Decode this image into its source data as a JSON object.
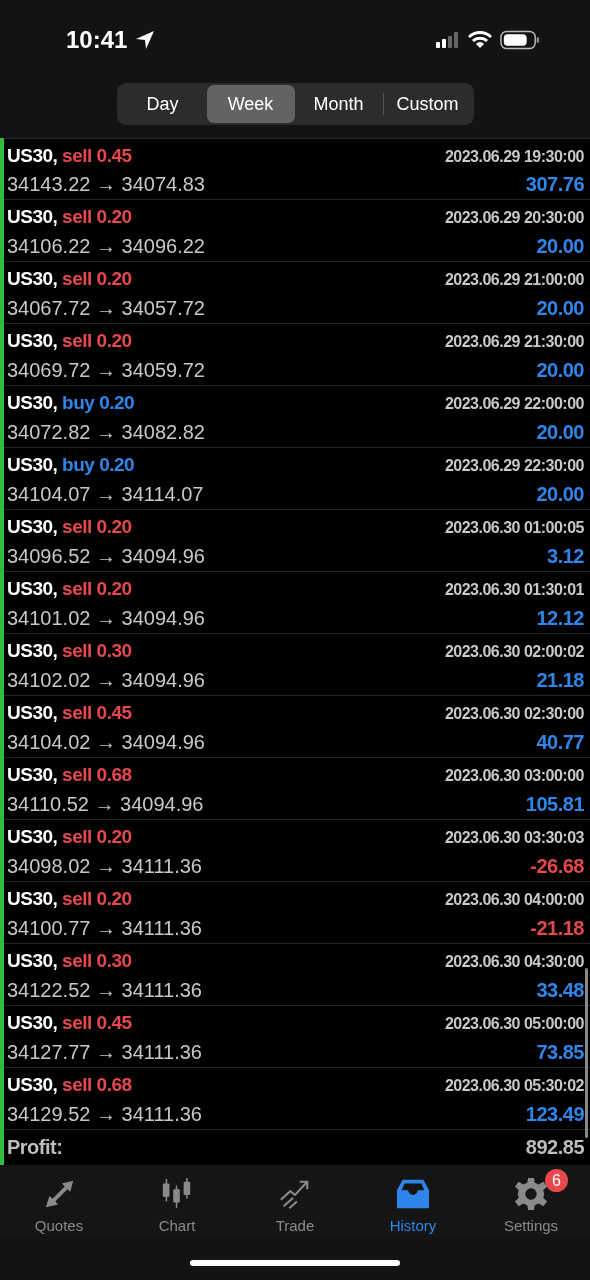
{
  "status_bar": {
    "time": "10:41"
  },
  "period_tabs": [
    {
      "label": "Day",
      "selected": false
    },
    {
      "label": "Week",
      "selected": true
    },
    {
      "label": "Month",
      "selected": false
    },
    {
      "label": "Custom",
      "selected": false
    }
  ],
  "trades": [
    {
      "symbol": "US30,",
      "kind": "sell",
      "side": "sell 0.45",
      "prices": "34143.22 → 34074.83",
      "time": "2023.06.29 19:30:00",
      "profit": "307.76",
      "loss": false
    },
    {
      "symbol": "US30,",
      "kind": "sell",
      "side": "sell 0.20",
      "prices": "34106.22 → 34096.22",
      "time": "2023.06.29 20:30:00",
      "profit": "20.00",
      "loss": false
    },
    {
      "symbol": "US30,",
      "kind": "sell",
      "side": "sell 0.20",
      "prices": "34067.72 → 34057.72",
      "time": "2023.06.29 21:00:00",
      "profit": "20.00",
      "loss": false
    },
    {
      "symbol": "US30,",
      "kind": "sell",
      "side": "sell 0.20",
      "prices": "34069.72 → 34059.72",
      "time": "2023.06.29 21:30:00",
      "profit": "20.00",
      "loss": false
    },
    {
      "symbol": "US30,",
      "kind": "buy",
      "side": "buy 0.20",
      "prices": "34072.82 → 34082.82",
      "time": "2023.06.29 22:00:00",
      "profit": "20.00",
      "loss": false
    },
    {
      "symbol": "US30,",
      "kind": "buy",
      "side": "buy 0.20",
      "prices": "34104.07 → 34114.07",
      "time": "2023.06.29 22:30:00",
      "profit": "20.00",
      "loss": false
    },
    {
      "symbol": "US30,",
      "kind": "sell",
      "side": "sell 0.20",
      "prices": "34096.52 → 34094.96",
      "time": "2023.06.30 01:00:05",
      "profit": "3.12",
      "loss": false
    },
    {
      "symbol": "US30,",
      "kind": "sell",
      "side": "sell 0.20",
      "prices": "34101.02 → 34094.96",
      "time": "2023.06.30 01:30:01",
      "profit": "12.12",
      "loss": false
    },
    {
      "symbol": "US30,",
      "kind": "sell",
      "side": "sell 0.30",
      "prices": "34102.02 → 34094.96",
      "time": "2023.06.30 02:00:02",
      "profit": "21.18",
      "loss": false
    },
    {
      "symbol": "US30,",
      "kind": "sell",
      "side": "sell 0.45",
      "prices": "34104.02 → 34094.96",
      "time": "2023.06.30 02:30:00",
      "profit": "40.77",
      "loss": false
    },
    {
      "symbol": "US30,",
      "kind": "sell",
      "side": "sell 0.68",
      "prices": "34110.52 → 34094.96",
      "time": "2023.06.30 03:00:00",
      "profit": "105.81",
      "loss": false
    },
    {
      "symbol": "US30,",
      "kind": "sell",
      "side": "sell 0.20",
      "prices": "34098.02 → 34111.36",
      "time": "2023.06.30 03:30:03",
      "profit": "-26.68",
      "loss": true
    },
    {
      "symbol": "US30,",
      "kind": "sell",
      "side": "sell 0.20",
      "prices": "34100.77 → 34111.36",
      "time": "2023.06.30 04:00:00",
      "profit": "-21.18",
      "loss": true
    },
    {
      "symbol": "US30,",
      "kind": "sell",
      "side": "sell 0.30",
      "prices": "34122.52 → 34111.36",
      "time": "2023.06.30 04:30:00",
      "profit": "33.48",
      "loss": false
    },
    {
      "symbol": "US30,",
      "kind": "sell",
      "side": "sell 0.45",
      "prices": "34127.77 → 34111.36",
      "time": "2023.06.30 05:00:00",
      "profit": "73.85",
      "loss": false
    },
    {
      "symbol": "US30,",
      "kind": "sell",
      "side": "sell 0.68",
      "prices": "34129.52 → 34111.36",
      "time": "2023.06.30 05:30:02",
      "profit": "123.49",
      "loss": false
    }
  ],
  "summary": {
    "label": "Profit:",
    "value": "892.85"
  },
  "tab_bar": [
    {
      "label": "Quotes",
      "kind": "quotes",
      "selected": false
    },
    {
      "label": "Chart",
      "kind": "chart",
      "selected": false
    },
    {
      "label": "Trade",
      "kind": "trade",
      "selected": false
    },
    {
      "label": "History",
      "kind": "history",
      "selected": true
    },
    {
      "label": "Settings",
      "kind": "settings",
      "selected": false,
      "badge": "6"
    }
  ]
}
